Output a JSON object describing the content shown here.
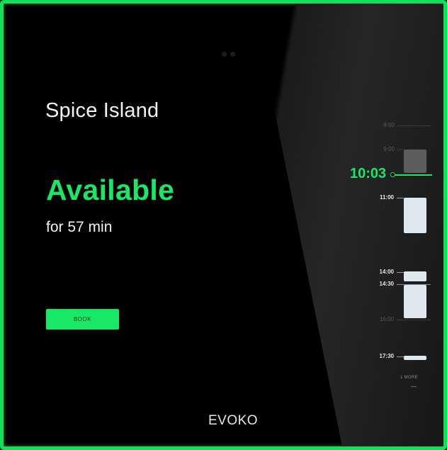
{
  "room": {
    "name": "Spice Island"
  },
  "status": {
    "label": "Available",
    "duration": "for 57 min"
  },
  "actions": {
    "book_label": "BOOK"
  },
  "brand": {
    "name": "EVOKO"
  },
  "timeline": {
    "now": "10:03",
    "labels": {
      "t0800": "8:00",
      "t0900": "9:00",
      "t1100": "11:00",
      "t1400": "14:00",
      "t1430": "14:30",
      "t1600": "16:00",
      "t1730": "17:30"
    },
    "more_label": "1 MORE"
  },
  "colors": {
    "accent": "#17e866",
    "background": "#000000",
    "booking_block": "#dfe8ee"
  }
}
